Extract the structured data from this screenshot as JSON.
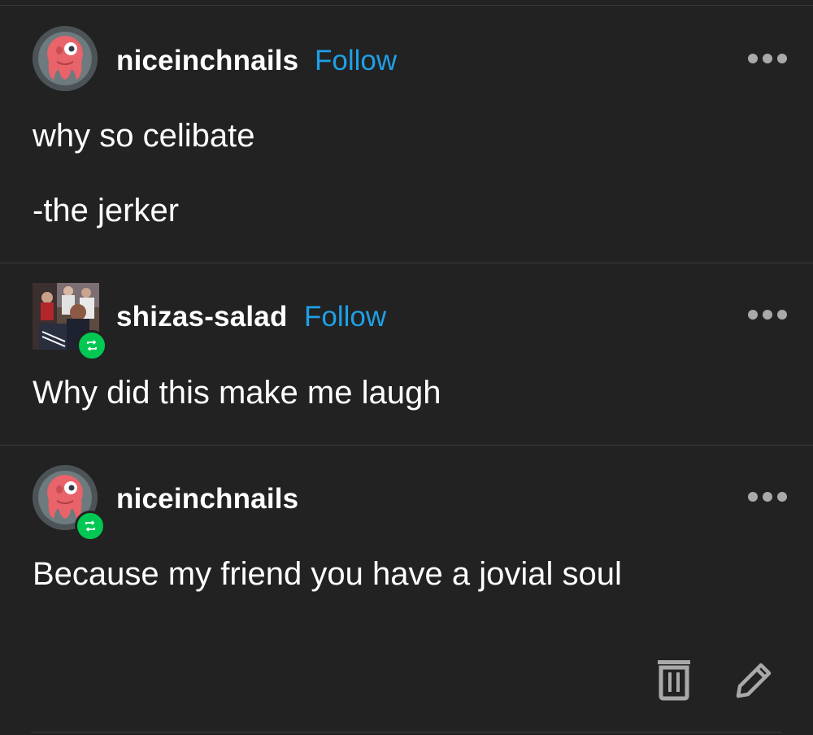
{
  "posts": [
    {
      "username": "niceinchnails",
      "follow_label": "Follow",
      "avatar": "pink-octopus-avatar",
      "paragraphs": [
        "why so celibate",
        "-the jerker"
      ]
    },
    {
      "username": "shizas-salad",
      "follow_label": "Follow",
      "avatar": "band-photo-avatar",
      "reblog_icon": "reblog-icon",
      "paragraphs": [
        "Why did this make me laugh"
      ]
    },
    {
      "username": "niceinchnails",
      "avatar": "pink-octopus-avatar",
      "reblog_icon": "reblog-icon",
      "paragraphs": [
        "Because my friend you have a jovial soul"
      ]
    }
  ],
  "footer": {
    "delete_icon": "trash-icon",
    "edit_icon": "pencil-icon"
  },
  "colors": {
    "background": "#222222",
    "text": "#ffffff",
    "follow": "#1ea0e6",
    "reblog_badge": "#00c853",
    "more_dots": "#a9a9a9"
  }
}
